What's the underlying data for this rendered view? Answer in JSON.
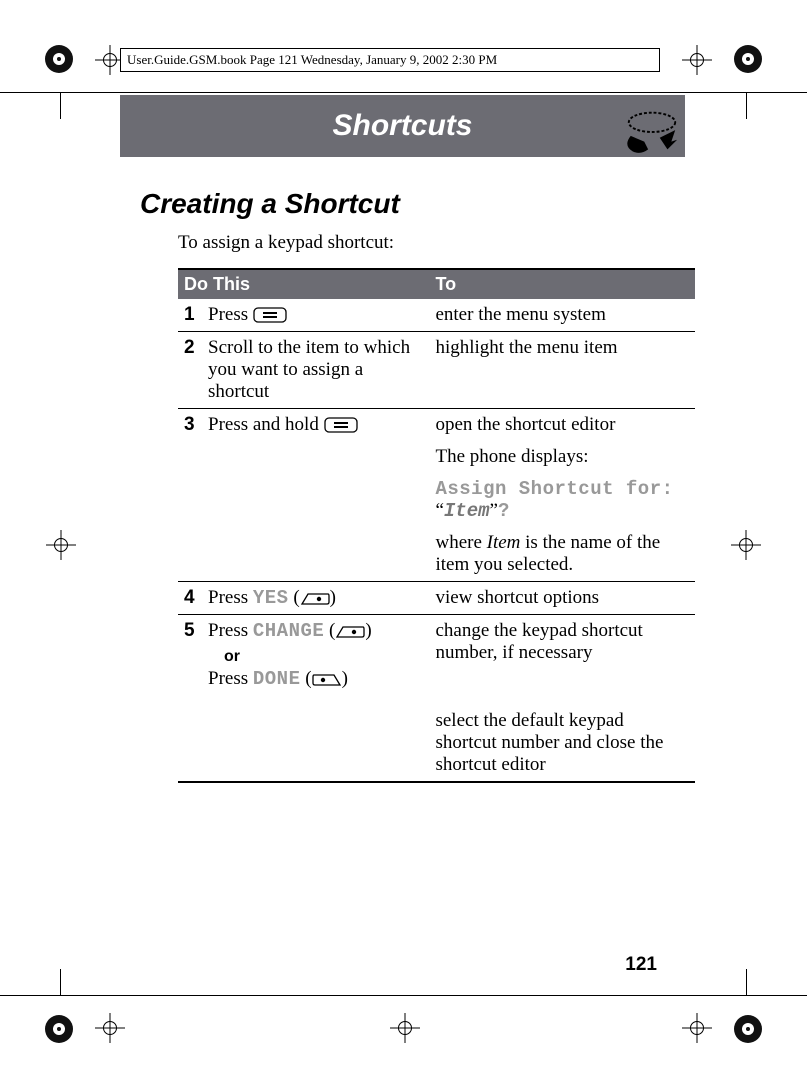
{
  "header_note": "User.Guide.GSM.book  Page 121  Wednesday, January 9, 2002  2:30 PM",
  "chapter_title": "Shortcuts",
  "section_title": "Creating a Shortcut",
  "intro": "To assign a keypad shortcut:",
  "table": {
    "head": {
      "do": "Do This",
      "to": "To"
    },
    "rows": [
      {
        "num": "1",
        "do_a": "Press ",
        "to": "enter the menu system"
      },
      {
        "num": "2",
        "do": "Scroll to the item to which you want to assign a shortcut",
        "to": "highlight the menu item"
      },
      {
        "num": "3",
        "do_a": "Press and hold ",
        "to_a": "open the shortcut editor",
        "to_b": "The phone displays:",
        "to_c_mono": "Assign Shortcut for:",
        "to_c_q1": "“",
        "to_c_item": "Item",
        "to_c_q2": "”",
        "to_c_mono2": "?",
        "to_d_a": "where ",
        "to_d_item": "Item",
        "to_d_b": " is the name of the item you selected."
      },
      {
        "num": "4",
        "do_a": "Press ",
        "do_mono": "YES",
        "do_b": " (",
        "do_c": ")",
        "to": "view shortcut options"
      },
      {
        "num": "5",
        "do_a": "Press ",
        "do_mono": "CHANGE",
        "do_b": " (",
        "do_c": ")",
        "or": "or",
        "do2_a": "Press ",
        "do2_mono": "DONE",
        "do2_b": " (",
        "do2_c": ")",
        "to": "change the keypad shortcut number, if necessary",
        "to2": "select the default keypad shortcut number and close the shortcut editor"
      }
    ]
  },
  "page_number": "121"
}
